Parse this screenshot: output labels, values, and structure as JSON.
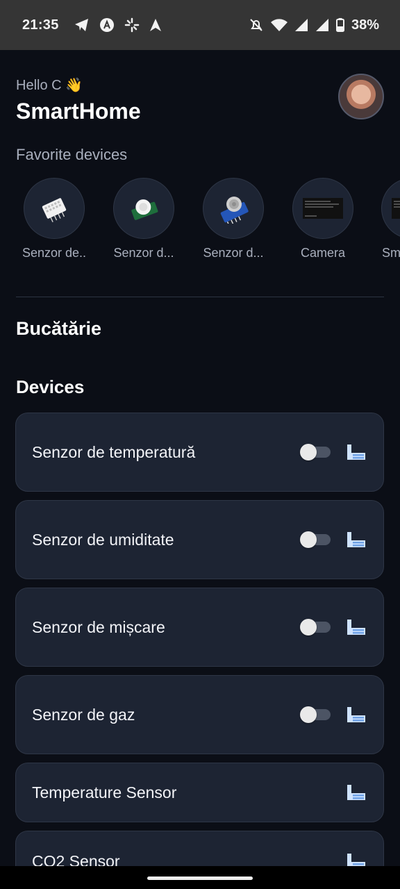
{
  "status_bar": {
    "time": "21:35",
    "battery_text": "38%",
    "left_icons": [
      "telegram-icon",
      "app-a-icon",
      "pinwheel-icon",
      "navigation-arrow-icon"
    ],
    "right_icons": [
      "muted-icon",
      "wifi-icon",
      "signal-icon",
      "signal-icon",
      "battery-icon"
    ]
  },
  "header": {
    "greeting": "Hello C 👋",
    "title": "SmartHome"
  },
  "favorites": {
    "heading": "Favorite devices",
    "items": [
      {
        "label": "Senzor de..",
        "icon": "dht-sensor-icon"
      },
      {
        "label": "Senzor d...",
        "icon": "pir-sensor-icon"
      },
      {
        "label": "Senzor d...",
        "icon": "gas-sensor-icon"
      },
      {
        "label": "Camera",
        "icon": "camera-thumbnail-icon"
      },
      {
        "label": "Sm",
        "icon": "camera-thumbnail-icon"
      }
    ]
  },
  "room": {
    "name": "Bucătărie",
    "devices_heading": "Devices",
    "devices": [
      {
        "name": "Senzor de temperatură",
        "has_toggle": true,
        "on": false
      },
      {
        "name": "Senzor de umiditate",
        "has_toggle": true,
        "on": false
      },
      {
        "name": "Senzor de mișcare",
        "has_toggle": true,
        "on": false
      },
      {
        "name": "Senzor de gaz",
        "has_toggle": true,
        "on": false
      },
      {
        "name": "Temperature Sensor",
        "has_toggle": false
      },
      {
        "name": "CO2 Sensor",
        "has_toggle": false
      }
    ]
  },
  "colors": {
    "background": "#0b0e16",
    "card": "#1d2433",
    "accent_icon": "#cfe3ff"
  }
}
